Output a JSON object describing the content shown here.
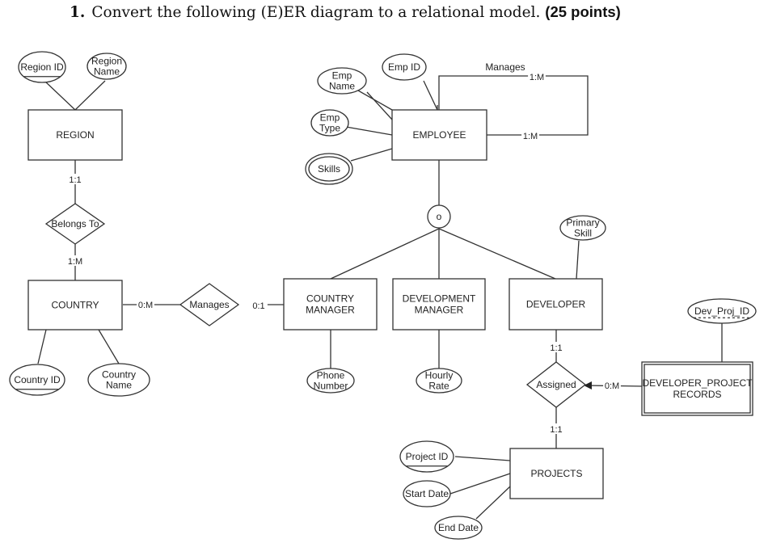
{
  "question": {
    "number": "1.",
    "text": "Convert the following (E)ER diagram to a relational model.",
    "points": "(25 points)"
  },
  "diagram": {
    "entities": {
      "region": "REGION",
      "country": "COUNTRY",
      "employee": "EMPLOYEE",
      "country_manager": [
        "COUNTRY",
        "MANAGER"
      ],
      "development_manager": [
        "DEVELOPMENT",
        "MANAGER"
      ],
      "developer": "DEVELOPER",
      "projects": "PROJECTS",
      "developer_project_records": [
        "DEVELOPER_PROJECT",
        "RECORDS"
      ]
    },
    "attributes": {
      "region_id": {
        "label": [
          "Region ID"
        ],
        "key": true
      },
      "region_name": {
        "label": [
          "Region",
          "Name"
        ]
      },
      "country_id": {
        "label": [
          "Country ID"
        ],
        "key": true
      },
      "country_name": {
        "label": [
          "Country",
          "Name"
        ]
      },
      "emp_id": {
        "label": [
          "Emp ID"
        ]
      },
      "emp_name": {
        "label": [
          "Emp",
          "Name"
        ]
      },
      "emp_type": {
        "label": [
          "Emp",
          "Type"
        ]
      },
      "skills": {
        "label": [
          "Skills"
        ],
        "multivalued": true
      },
      "primary_skill": {
        "label": [
          "Primary",
          "Skill"
        ]
      },
      "phone_number": {
        "label": [
          "Phone",
          "Number"
        ]
      },
      "hourly_rate": {
        "label": [
          "Hourly",
          "Rate"
        ]
      },
      "dev_proj_id": {
        "label": [
          "Dev_Proj_ID"
        ],
        "partial_key": true
      },
      "project_id": {
        "label": [
          "Project ID"
        ],
        "key": true
      },
      "start_date": {
        "label": [
          "Start Date"
        ]
      },
      "end_date": {
        "label": [
          "End Date"
        ]
      }
    },
    "relationships": {
      "belongs_to": {
        "label": "Belongs To",
        "card_top": "1:1",
        "card_bottom": "1:M"
      },
      "manages_country": {
        "label": "Manages",
        "card_left": "0:M",
        "card_right": "0:1"
      },
      "manages_self": {
        "label": "Manages",
        "card_top": "1:M",
        "card_bottom": "1:M"
      },
      "assigned": {
        "label": "Assigned",
        "card_top": "1:1",
        "card_bottom": "1:1",
        "card_right": "0:M"
      }
    },
    "specialization": {
      "type_symbol": "o",
      "meaning": "overlapping"
    }
  }
}
